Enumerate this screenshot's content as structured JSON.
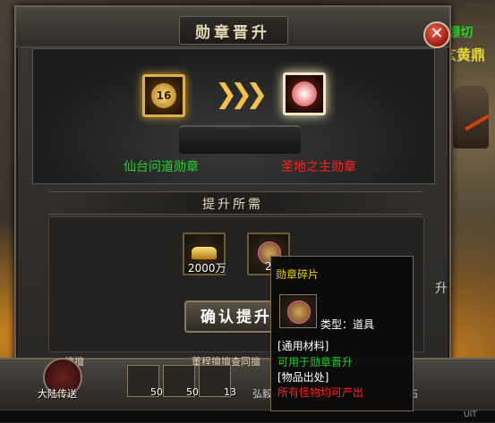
{
  "window": {
    "title": "勋章晋升",
    "close_symbol": "✕"
  },
  "side": {
    "text_top": "[爆切",
    "text_mid": "玄黄鼎"
  },
  "upgrade": {
    "from_medal_level": "16",
    "from_name": "仙台问道勋章",
    "to_name": "圣地之主勋章",
    "arrow": "❯❯❯"
  },
  "requirements": {
    "section_title": "提升所需",
    "gold_amount": "2000万",
    "fragment_count": "2",
    "confirm_label": "确认提升"
  },
  "tooltip": {
    "title": "勋章碎片",
    "type_label": "类型：道具",
    "line1": "[通用材料]",
    "line2": "可用于勋章晋升",
    "line3": "[物品出处]",
    "line4": "所有怪物均可产出"
  },
  "hotbar": {
    "teleport_label": "大陆传送",
    "chat_left": "擅擅",
    "chat_mid": "董程擅擅查同擅",
    "slot1_count": "50",
    "slot2_count": "50",
    "slot3_count": "13",
    "extra_text": "弘毅",
    "right_text": "石",
    "strip_right": "UIT",
    "side_hint": "升"
  },
  "colors": {
    "green_text": "#22d02a",
    "red_text": "#ff2020",
    "gold_text": "#e6d200"
  }
}
